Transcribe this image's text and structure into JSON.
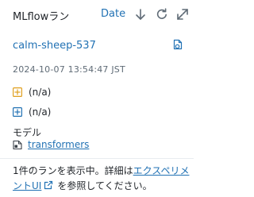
{
  "header": {
    "title": "MLflowラン",
    "sort_label": "Date",
    "icons": [
      "sort-arrow-down-icon",
      "refresh-icon",
      "expand-icon"
    ]
  },
  "run": {
    "name": "calm-sheep-537",
    "timestamp": "2024-10-07 13:54:47 JST",
    "metrics_value": "(n/a)",
    "params_value": "(n/a)",
    "model_label": "モデル",
    "model_link": "transformers"
  },
  "footer": {
    "text_before": "1件のランを表示中。詳細は",
    "link_text": "エクスペリメントUI",
    "text_after": "を参照してください。"
  },
  "colors": {
    "link": "#2272b4",
    "metric_icon": "#e0a020",
    "param_icon": "#2272b4"
  }
}
